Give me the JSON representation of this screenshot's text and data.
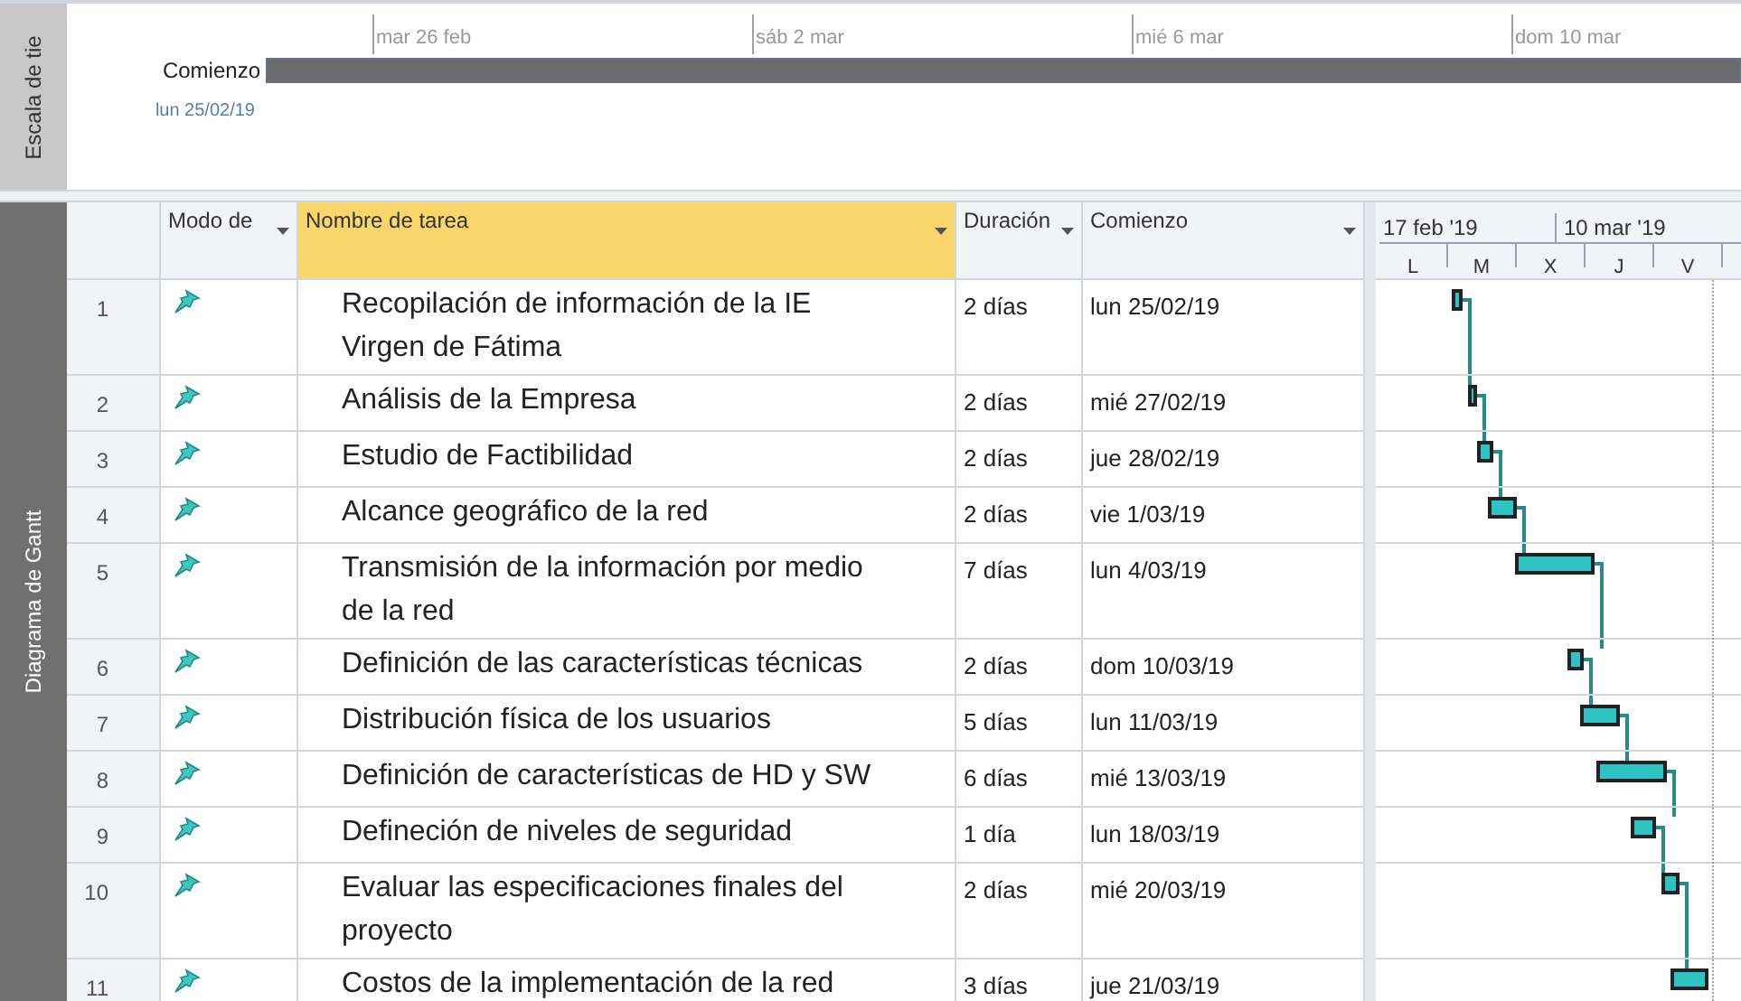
{
  "timeline": {
    "side_label": "Escala de tie",
    "ticks": [
      "mar 26 feb",
      "sáb 2 mar",
      "mié 6 mar",
      "dom 10 mar"
    ],
    "start_label": "Comienzo",
    "start_date": "lun 25/02/19"
  },
  "view_label": "Diagrama de Gantt",
  "table": {
    "columns": [
      {
        "label": "Modo de",
        "selected": false
      },
      {
        "label": "Nombre de tarea",
        "selected": true
      },
      {
        "label": "Duración",
        "selected": false
      },
      {
        "label": "Comienzo",
        "selected": false
      }
    ],
    "rows": [
      {
        "id": "1",
        "name": "Recopilación de información de la IE Virgen de Fátima",
        "duration": "2 días",
        "start": "lun 25/02/19"
      },
      {
        "id": "2",
        "name": "Análisis de la Empresa",
        "duration": "2 días",
        "start": "mié 27/02/19"
      },
      {
        "id": "3",
        "name": "Estudio de Factibilidad",
        "duration": "2 días",
        "start": "jue 28/02/19"
      },
      {
        "id": "4",
        "name": "Alcance geográfico de la red",
        "duration": "2 días",
        "start": "vie 1/03/19"
      },
      {
        "id": "5",
        "name": "Transmisión de la información por medio de la red",
        "duration": "7 días",
        "start": "lun 4/03/19"
      },
      {
        "id": "6",
        "name": "Definición de las características técnicas",
        "duration": "2 días",
        "start": "dom 10/03/19"
      },
      {
        "id": "7",
        "name": "Distribución física de los usuarios",
        "duration": "5 días",
        "start": "lun 11/03/19"
      },
      {
        "id": "8",
        "name": "Definición de características de HD y SW",
        "duration": "6 días",
        "start": "mié 13/03/19"
      },
      {
        "id": "9",
        "name": "Defineción de niveles de seguridad",
        "duration": "1 día",
        "start": "lun 18/03/19"
      },
      {
        "id": "10",
        "name": "Evaluar las especificaciones finales del proyecto",
        "duration": "2 días",
        "start": "mié 20/03/19"
      },
      {
        "id": "11",
        "name": "Costos de la implementación de la red",
        "duration": "3 días",
        "start": "jue 21/03/19"
      }
    ]
  },
  "chart_scale": {
    "periods": [
      "17 feb '19",
      "10 mar '19"
    ],
    "days": [
      "L",
      "M",
      "X",
      "J",
      "V"
    ]
  }
}
